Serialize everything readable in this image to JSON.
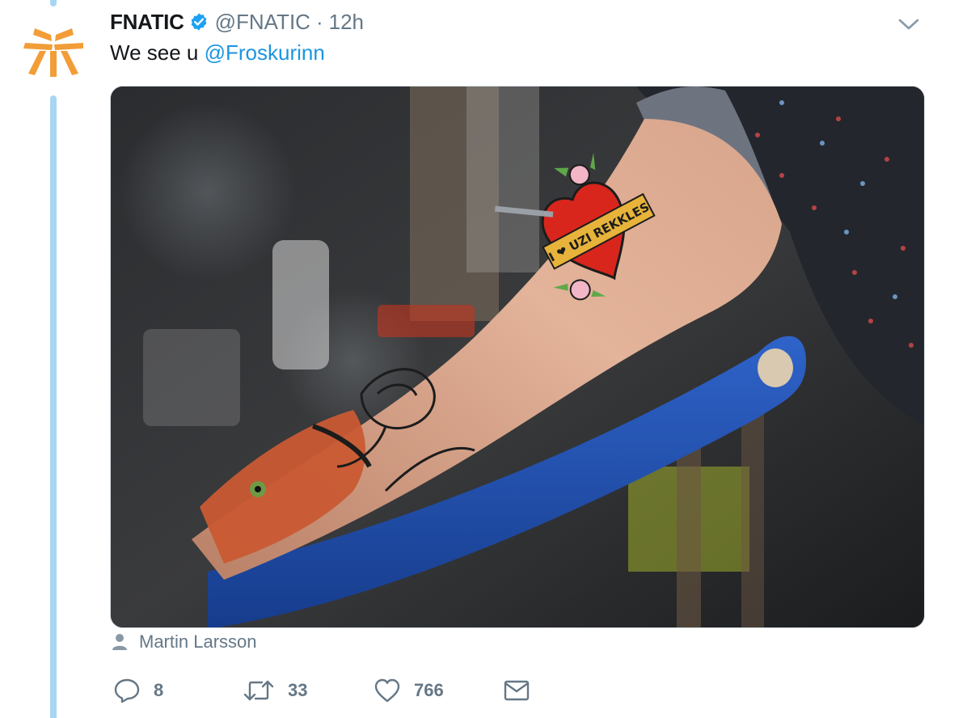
{
  "tweet": {
    "display_name": "FNATIC",
    "handle": "@FNATIC",
    "separator": "·",
    "timestamp": "12h",
    "text_prefix": "We see u ",
    "mention": "@Froskurinn",
    "verified": true
  },
  "media": {
    "tattoo_banner_text": "I ❤ UZI REKKLES",
    "photo_credit": "Martin Larsson"
  },
  "actions": {
    "replies": "8",
    "retweets": "33",
    "likes": "766"
  },
  "colors": {
    "link": "#1b95e0",
    "muted": "#657786",
    "verified": "#1da1f2",
    "brand_orange": "#f29d38",
    "thread": "#a8d6f2"
  },
  "icons": [
    "fnatic-logo",
    "verified-icon",
    "chevron-down-icon",
    "person-icon",
    "reply-icon",
    "retweet-icon",
    "heart-icon",
    "mail-icon"
  ]
}
